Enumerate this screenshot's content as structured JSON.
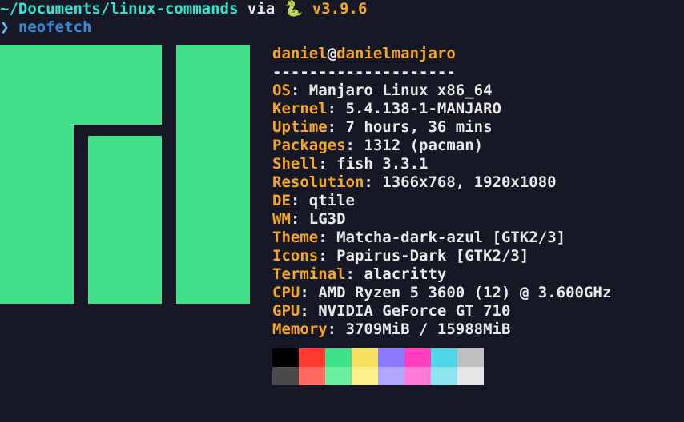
{
  "prompt": {
    "path": "~/Documents/linux-commands",
    "via_word": "via",
    "snake": "🐍",
    "version": "v3.9.6",
    "symbol": "❯",
    "command": "neofetch"
  },
  "title": {
    "user": "daniel",
    "at": "@",
    "host": "danielmanjaro"
  },
  "separator": "--------------------",
  "rows": [
    {
      "key": "OS",
      "val": "Manjaro Linux x86_64"
    },
    {
      "key": "Kernel",
      "val": "5.4.138-1-MANJARO"
    },
    {
      "key": "Uptime",
      "val": "7 hours, 36 mins"
    },
    {
      "key": "Packages",
      "val": "1312 (pacman)"
    },
    {
      "key": "Shell",
      "val": "fish 3.3.1"
    },
    {
      "key": "Resolution",
      "val": "1366x768, 1920x1080"
    },
    {
      "key": "DE",
      "val": "qtile"
    },
    {
      "key": "WM",
      "val": "LG3D"
    },
    {
      "key": "Theme",
      "val": "Matcha-dark-azul [GTK2/3]"
    },
    {
      "key": "Icons",
      "val": "Papirus-Dark [GTK2/3]"
    },
    {
      "key": "Terminal",
      "val": "alacritty"
    },
    {
      "key": "CPU",
      "val": "AMD Ryzen 5 3600 (12) @ 3.600GHz"
    },
    {
      "key": "GPU",
      "val": "NVIDIA GeForce GT 710"
    },
    {
      "key": "Memory",
      "val": "3709MiB / 15988MiB"
    }
  ],
  "palette": {
    "dark": [
      "#000000",
      "#ff3b30",
      "#41e08b",
      "#f6e05e",
      "#8a7cff",
      "#ff3fbf",
      "#4fd5e8",
      "#c0c0c0"
    ],
    "light": [
      "#4a4a4a",
      "#ff6b61",
      "#6aef9f",
      "#fbf08a",
      "#b0a6ff",
      "#ff7ad6",
      "#8de5f2",
      "#e6e6e6"
    ]
  },
  "logo_color": "#41e08b"
}
